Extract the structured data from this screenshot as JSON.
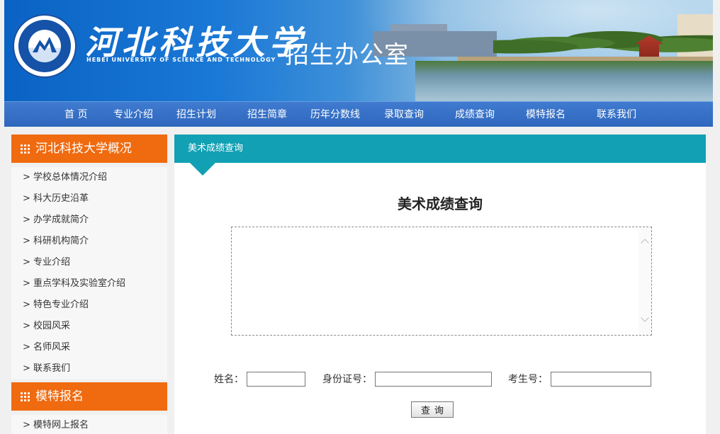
{
  "header": {
    "school_cn": "河北科技大学",
    "school_en": "HEBEI UNIVERSITY OF SCIENCE AND TECHNOLOGY",
    "office": "招生办公室"
  },
  "nav": {
    "items": [
      "首  页",
      "专业介绍",
      "招生计划",
      "招生简章",
      "历年分数线",
      "录取查询",
      "成绩查询",
      "模特报名",
      "联系我们"
    ]
  },
  "sidebar": {
    "section1": {
      "title": "河北科技大学概况",
      "items": [
        "> 学校总体情况介绍",
        "> 科大历史沿革",
        "> 办学成就简介",
        "> 科研机构简介",
        "> 专业介绍",
        "> 重点学科及实验室介绍",
        "> 特色专业介绍",
        "> 校园风采",
        "> 名师风采",
        "> 联系我们"
      ]
    },
    "section2": {
      "title": "模特报名",
      "items": [
        "> 模特网上报名"
      ]
    }
  },
  "main": {
    "breadcrumb": "美术成绩查询",
    "title": "美术成绩查询",
    "form": {
      "name_label": "姓名：",
      "name_value": "",
      "id_label": "身份证号：",
      "id_value": "",
      "exam_label": "考生号：",
      "exam_value": "",
      "submit_label": "查询"
    }
  }
}
